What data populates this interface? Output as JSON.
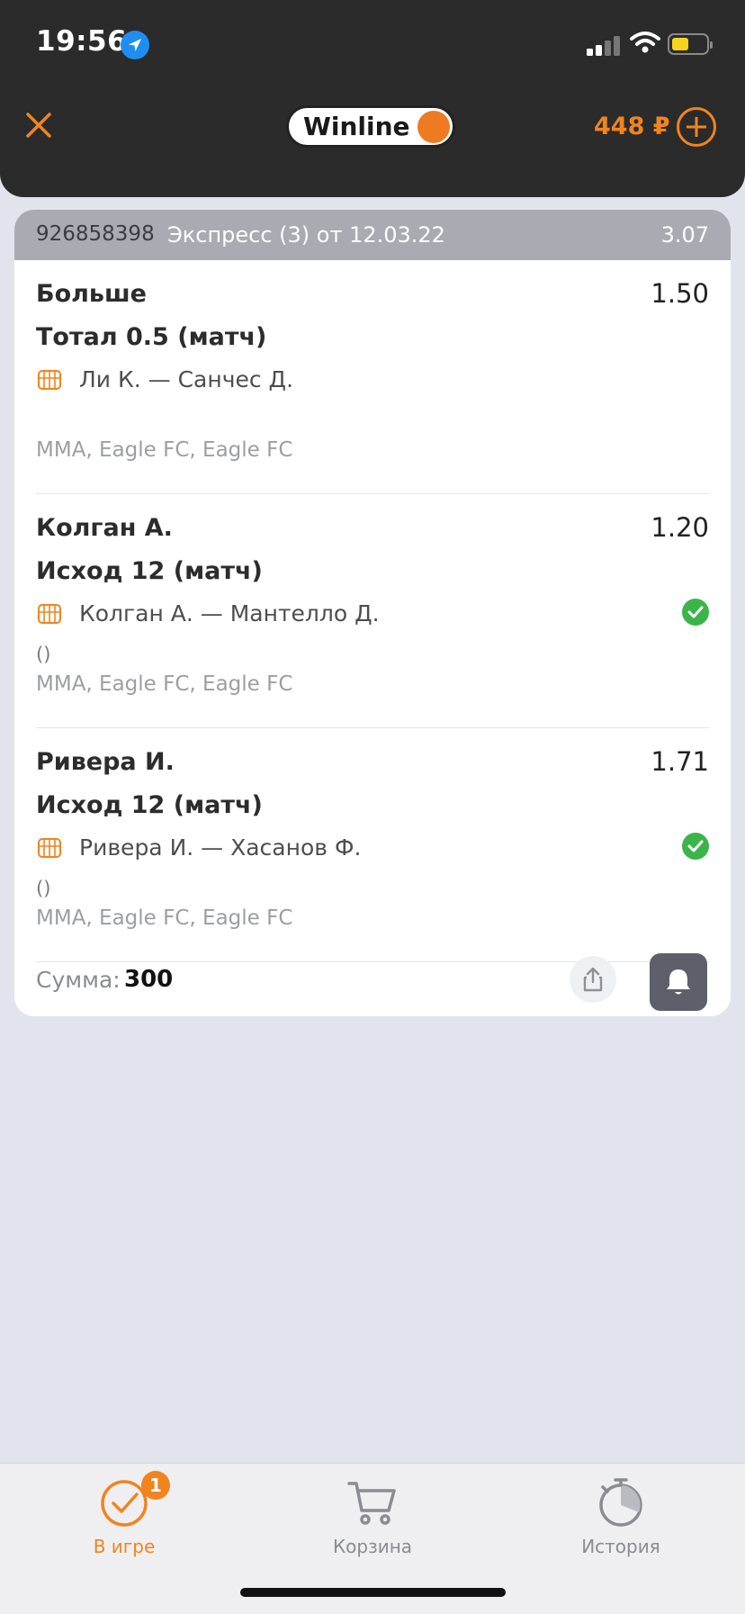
{
  "status_bar": {
    "time": "19:56"
  },
  "header": {
    "logo_text": "Winline",
    "balance": "448 ₽"
  },
  "bet": {
    "id": "926858398",
    "type": "Экспресс (3) от 12.03.22",
    "total_coef": "3.07",
    "events": [
      {
        "title": "Больше",
        "coef": "1.50",
        "market": "Тотал 0.5 (матч)",
        "match": "Ли К. — Санчес Д.",
        "score": "",
        "league": "MMA, Eagle FC, Eagle FC",
        "won": false
      },
      {
        "title": "Колган А.",
        "coef": "1.20",
        "market": "Исход 12 (матч)",
        "match": "Колган А. — Мантелло Д.",
        "score": "()",
        "league": "MMA, Eagle FC, Eagle FC",
        "won": true
      },
      {
        "title": "Ривера И.",
        "coef": "1.71",
        "market": "Исход 12 (матч)",
        "match": "Ривера И. — Хасанов Ф.",
        "score": "()",
        "league": "MMA, Eagle FC, Eagle FC",
        "won": true
      }
    ],
    "sum_label": "Сумма:",
    "sum_value": "300"
  },
  "tabs": [
    {
      "label": "В игре",
      "icon": "check-circle-icon",
      "active": true,
      "badge": "1"
    },
    {
      "label": "Корзина",
      "icon": "cart-icon",
      "active": false
    },
    {
      "label": "История",
      "icon": "history-timer-icon",
      "active": false
    }
  ],
  "colors": {
    "accent": "#f0841f",
    "header_bg": "#2b2b2b",
    "page_bg": "#e1e4ed",
    "success": "#3bb54a",
    "card_header": "#a8abb2"
  }
}
